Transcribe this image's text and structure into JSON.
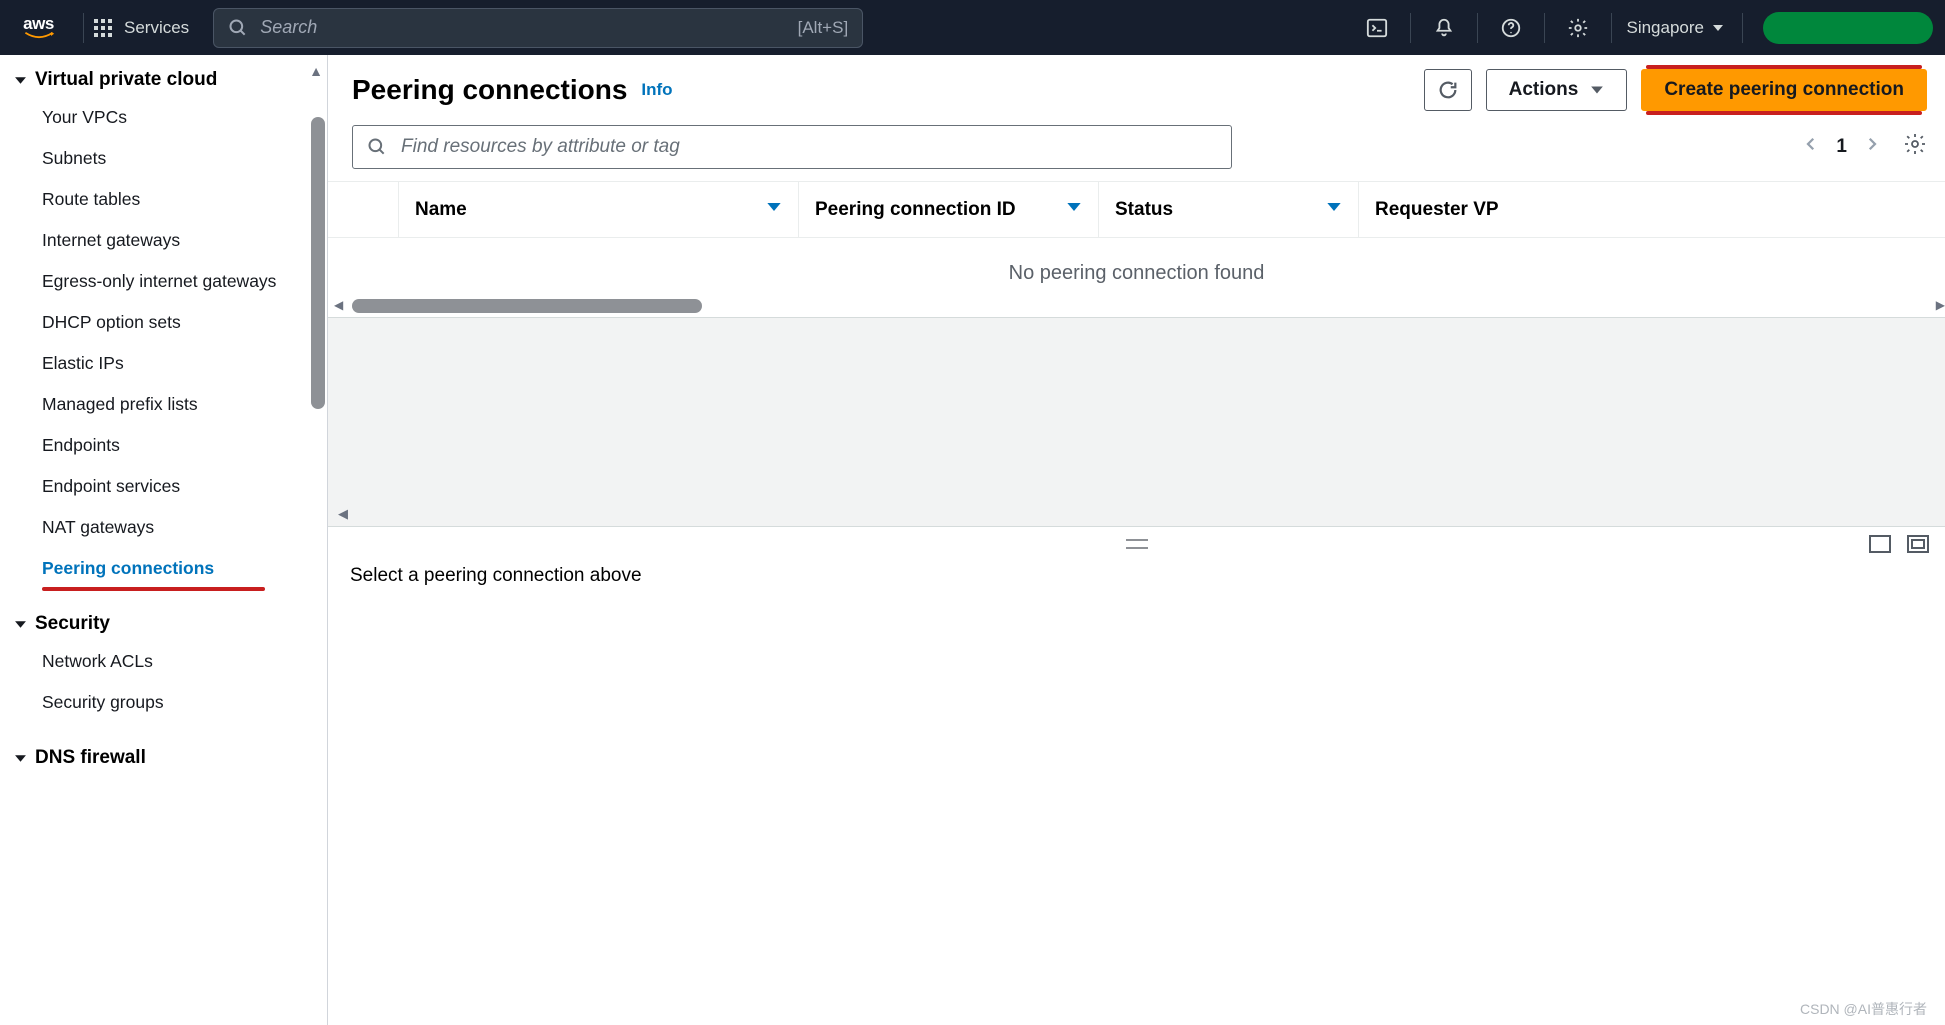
{
  "nav": {
    "logo_text": "aws",
    "services_label": "Services",
    "search_placeholder": "Search",
    "search_shortcut": "[Alt+S]",
    "region": "Singapore"
  },
  "sidebar": {
    "vpc_section": "Virtual private cloud",
    "items": {
      "your_vpcs": "Your VPCs",
      "subnets": "Subnets",
      "route_tables": "Route tables",
      "internet_gateways": "Internet gateways",
      "egress_gateways": "Egress-only internet gateways",
      "dhcp_option_sets": "DHCP option sets",
      "elastic_ips": "Elastic IPs",
      "managed_prefix_lists": "Managed prefix lists",
      "endpoints": "Endpoints",
      "endpoint_services": "Endpoint services",
      "nat_gateways": "NAT gateways",
      "peering_connections": "Peering connections"
    },
    "security_section": "Security",
    "security_items": {
      "network_acls": "Network ACLs",
      "security_groups": "Security groups"
    },
    "dns_section": "DNS firewall"
  },
  "main": {
    "title": "Peering connections",
    "info": "Info",
    "actions_label": "Actions",
    "create_label": "Create peering connection",
    "filter_placeholder": "Find resources by attribute or tag",
    "page": "1",
    "columns": {
      "name": "Name",
      "peering_id": "Peering connection ID",
      "status": "Status",
      "requester": "Requester VP"
    },
    "empty_msg": "No peering connection found",
    "detail_msg": "Select a peering connection above"
  },
  "watermark": "CSDN @AI普惠行者"
}
